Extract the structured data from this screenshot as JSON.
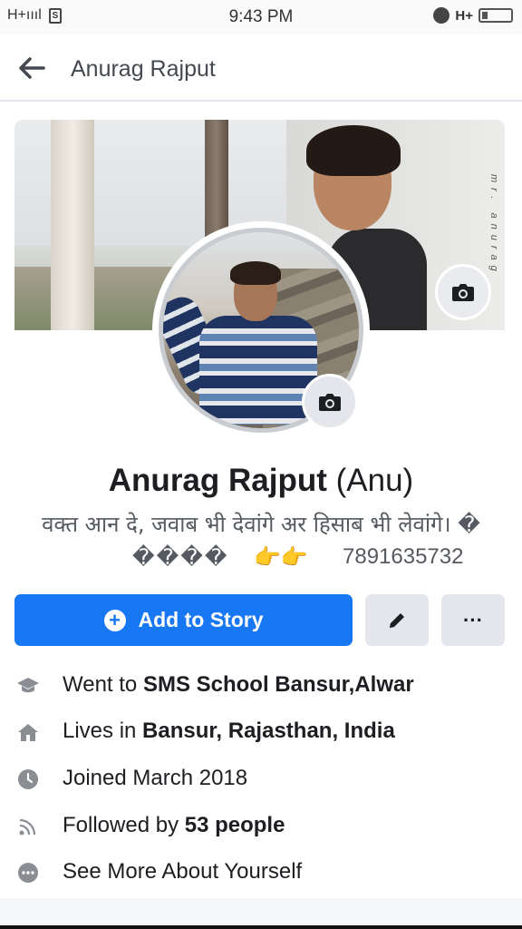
{
  "status_bar": {
    "network": "H+ıııl",
    "sim": "S",
    "time": "9:43 PM",
    "network_right": "H+"
  },
  "header": {
    "title": "Anurag Rajput"
  },
  "cover": {
    "watermark": "mr. anurag"
  },
  "profile": {
    "name": "Anurag Rajput",
    "alternate_name": "(Anu)",
    "bio_line1": "वक्त आन दे, जवाब भी देवांगे अर हिसाब भी लेवांगे। �",
    "bio_placeholders": "����",
    "bio_emoji": "👉👉",
    "bio_phone": "7891635732"
  },
  "actions": {
    "add_story_label": "Add to Story",
    "more_label": "···"
  },
  "intro": [
    {
      "prefix": "Went to ",
      "bold": "SMS School Bansur,Alwar",
      "icon": "graduation-cap-icon"
    },
    {
      "prefix": "Lives in ",
      "bold": "Bansur, Rajasthan, India",
      "icon": "home-icon"
    },
    {
      "prefix": "Joined March 2018",
      "bold": "",
      "icon": "clock-icon"
    },
    {
      "prefix": "Followed by ",
      "bold": "53 people",
      "icon": "rss-icon"
    },
    {
      "prefix": "See More About Yourself",
      "bold": "",
      "icon": "more-circle-icon"
    }
  ],
  "colors": {
    "accent": "#1877f2",
    "button_gray": "#e4e6eb",
    "icon_gray": "#8a8d91"
  }
}
